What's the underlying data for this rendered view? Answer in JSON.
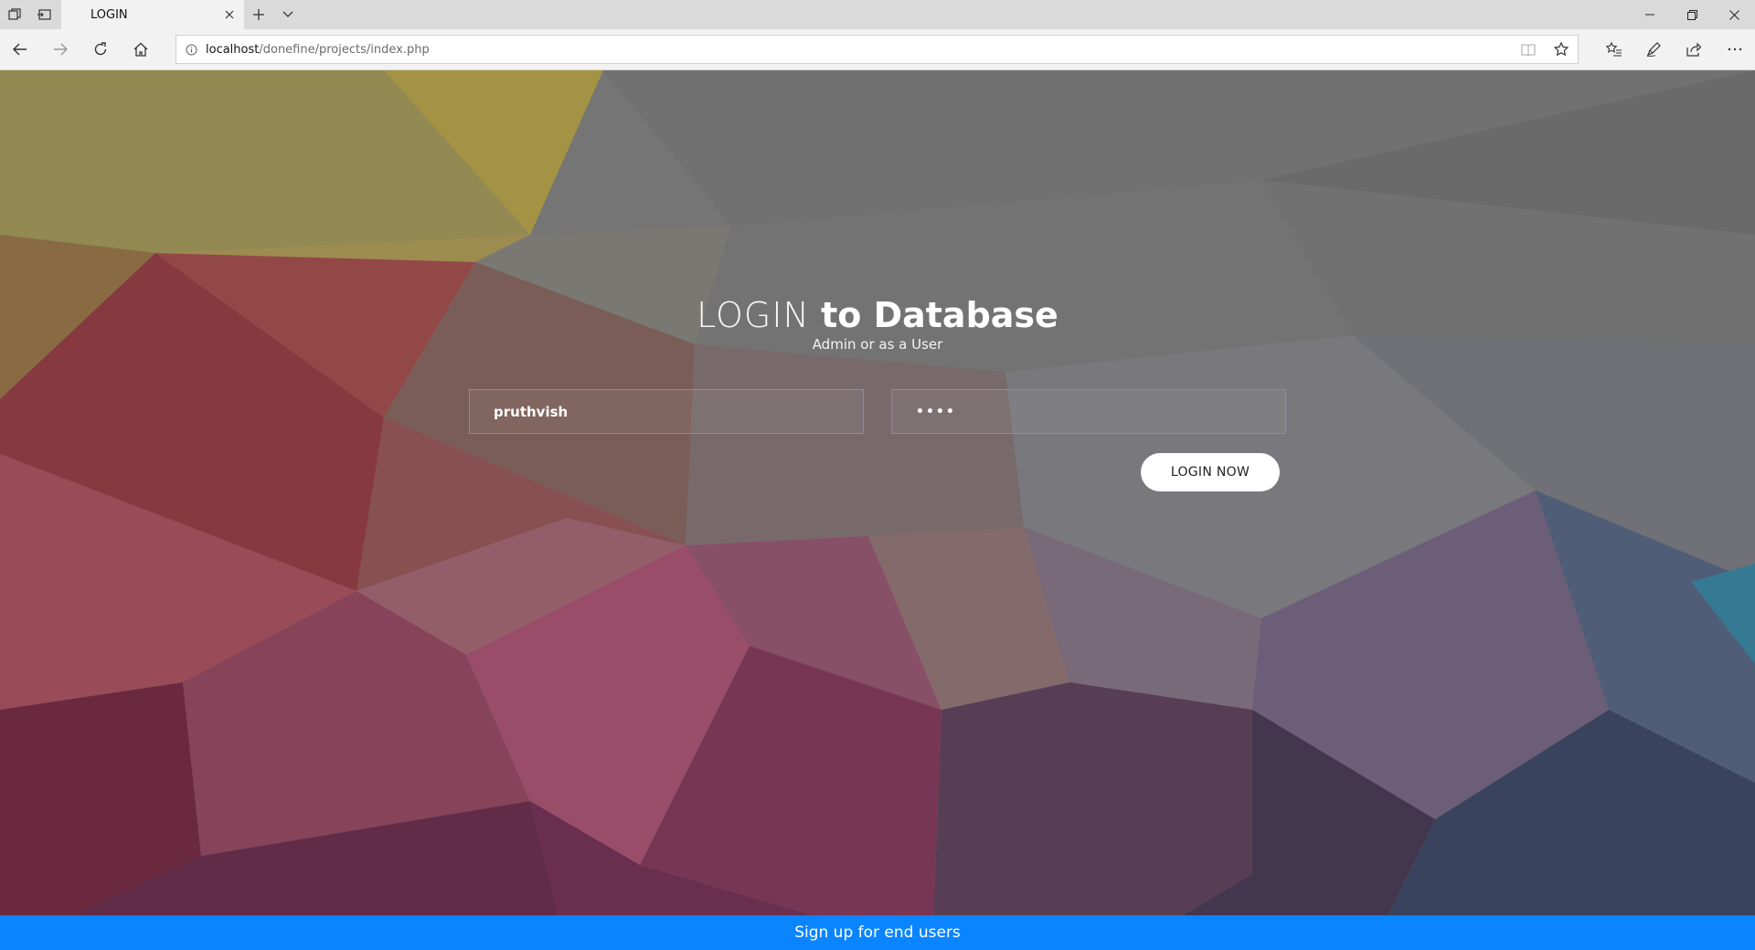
{
  "browser": {
    "tab_title": "LOGIN",
    "url_host": "localhost",
    "url_path": "/donefine/projects/index.php"
  },
  "login": {
    "title_light": "LOGIN",
    "title_bold": "to Database",
    "subtitle": "Admin or as a User",
    "username_value": "pruthvish",
    "password_mask": "••••",
    "login_button": "LOGIN NOW"
  },
  "footer": {
    "signup_label": "Sign up for end users"
  },
  "colors": {
    "signup_bar": "#0a84ff",
    "field_border": "#8f7fd8",
    "page_overlay": "#6e6e6e"
  },
  "icons": {
    "tab_aside": "tabs-aside-icon",
    "tab_preview": "tab-preview-icon",
    "close_tab": "close-icon",
    "new_tab": "plus-icon",
    "tab_menu": "chevron-down-icon",
    "back": "back-arrow-icon",
    "forward": "forward-arrow-icon",
    "refresh": "refresh-icon",
    "home": "home-icon",
    "site_info": "info-icon",
    "reading_view": "book-icon",
    "favorite": "star-icon",
    "favorites_hub": "favorites-list-icon",
    "notes": "pen-icon",
    "share": "share-icon",
    "more": "more-icon",
    "minimize": "minimize-icon",
    "restore": "restore-icon",
    "close_window": "close-icon"
  }
}
